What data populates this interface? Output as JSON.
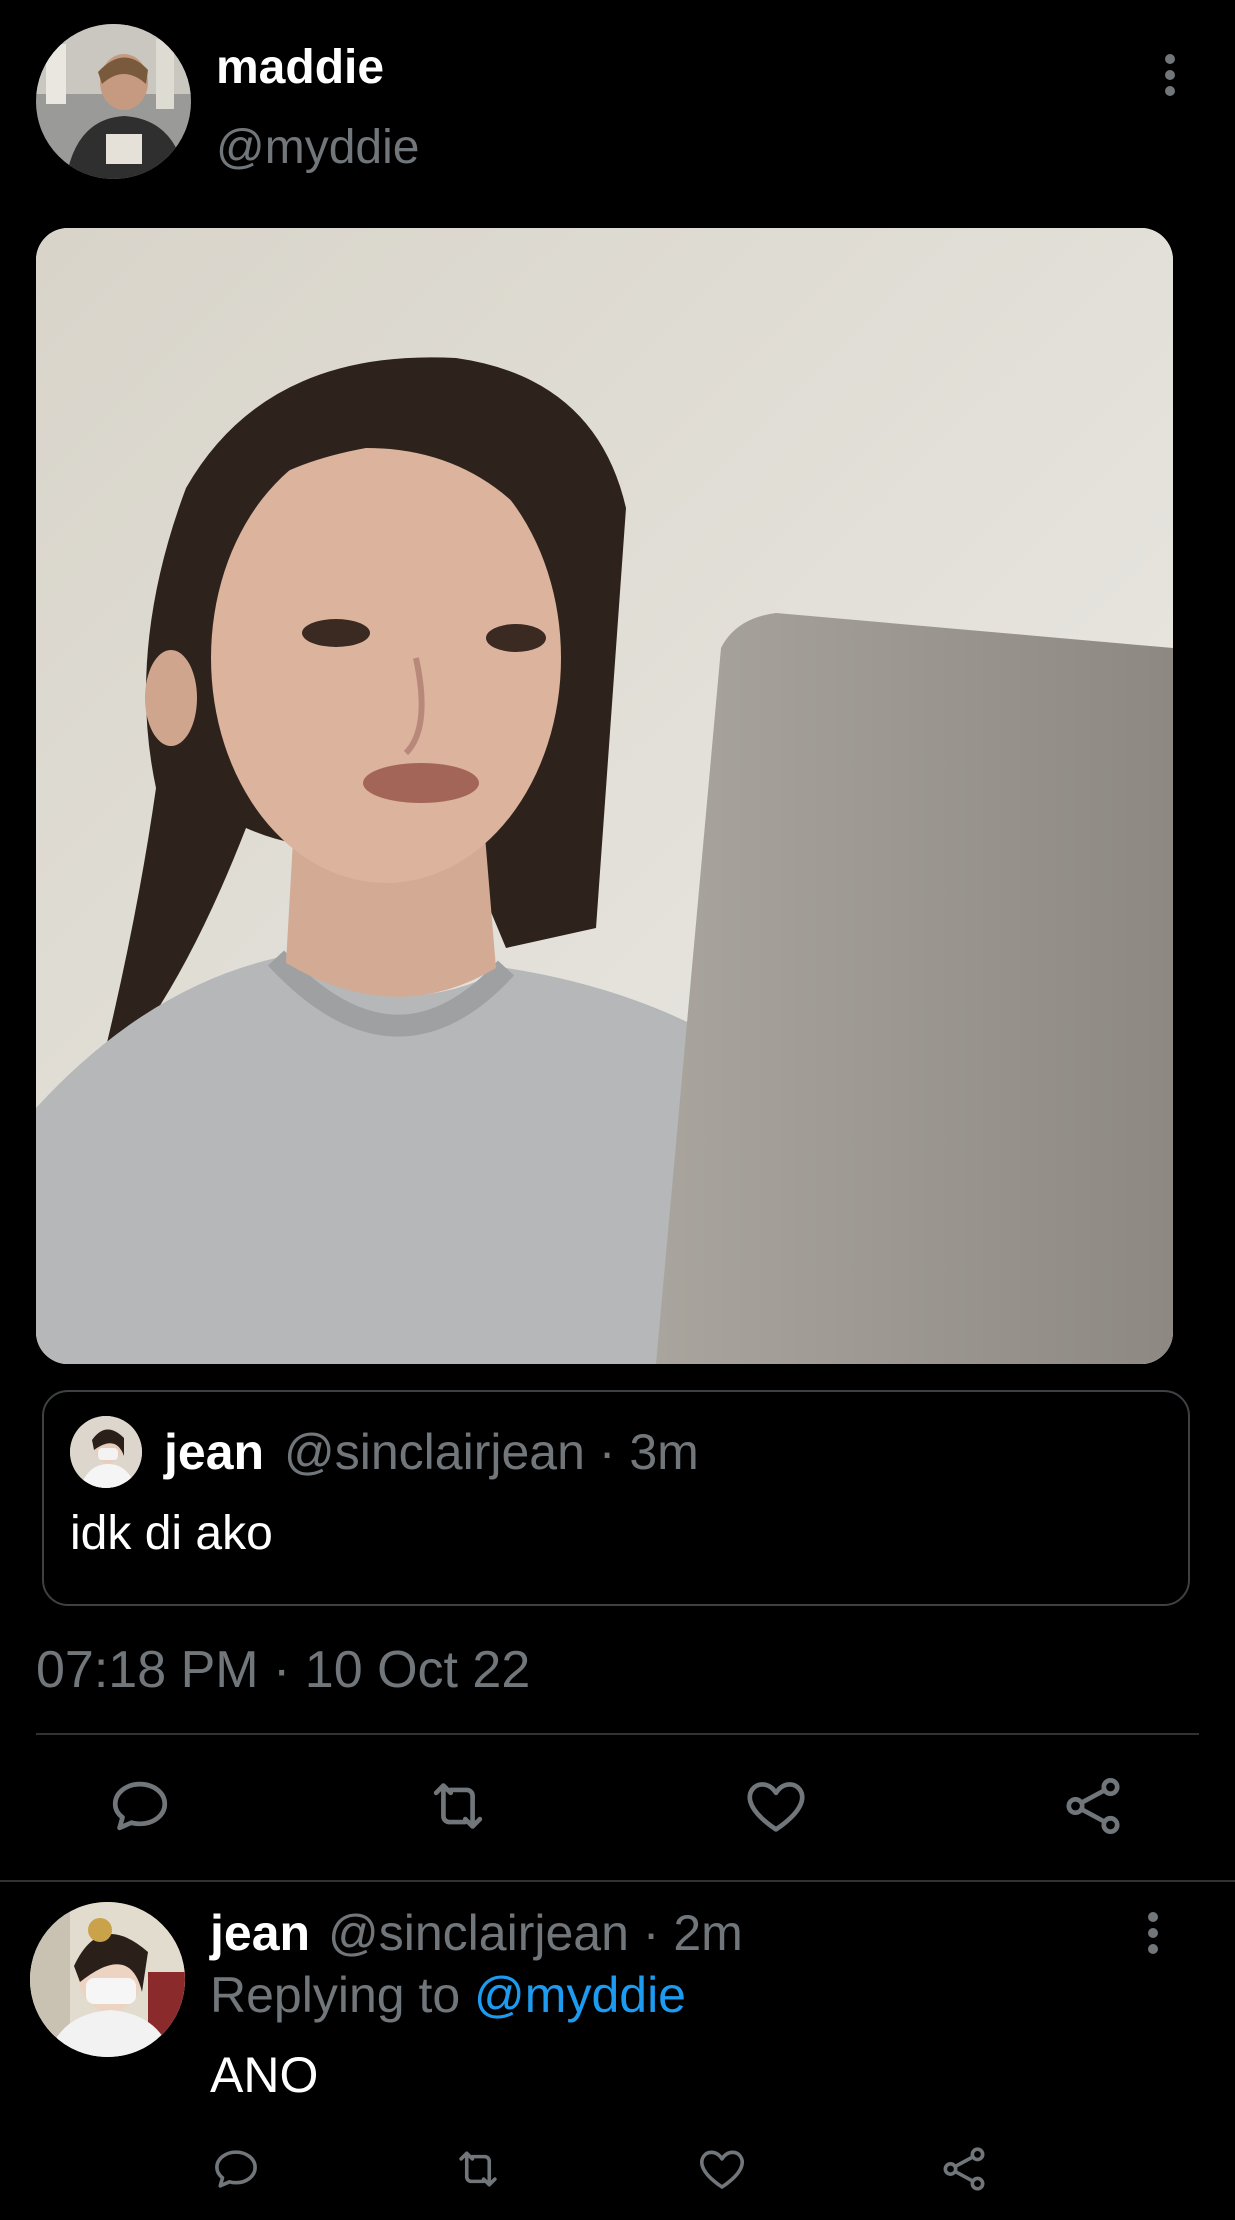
{
  "tweet": {
    "display_name": "maddie",
    "handle": "@myddie",
    "timestamp": "07:18 PM · 10 Oct 22"
  },
  "quoted": {
    "name": "jean",
    "meta": "@sinclairjean · 3m",
    "text": "idk di ako"
  },
  "reply": {
    "name": "jean",
    "meta": "@sinclairjean · 2m",
    "replying_prefix": "Replying to ",
    "replying_to": "@myddie",
    "text": "ANO"
  },
  "icons": {
    "more": "more-vertical-icon",
    "reply": "comment-bubble-icon",
    "retweet": "retweet-icon",
    "like": "heart-icon",
    "share": "share-icon"
  },
  "colors": {
    "background": "#000000",
    "muted_text": "#71767b",
    "accent": "#1d9bf0",
    "divider": "#2f3336"
  }
}
